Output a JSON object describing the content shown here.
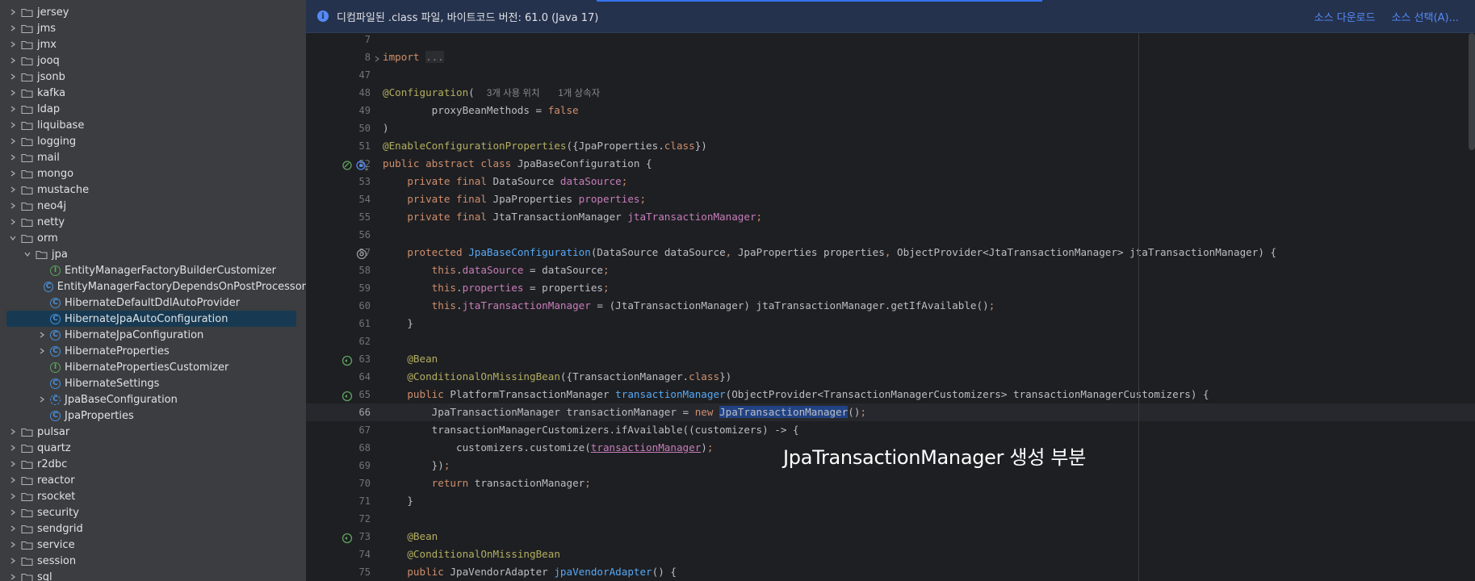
{
  "tree": {
    "folders_top": [
      "jersey",
      "jms",
      "jmx",
      "jooq",
      "jsonb",
      "kafka",
      "ldap",
      "liquibase",
      "logging",
      "mail",
      "mongo",
      "mustache",
      "neo4j",
      "netty"
    ],
    "orm": "orm",
    "jpa": "jpa",
    "jpa_children": [
      {
        "label": "EntityManagerFactoryBuilderCustomizer",
        "icon": "interface-icon",
        "expandable": false
      },
      {
        "label": "EntityManagerFactoryDependsOnPostProcessor",
        "icon": "class-icon",
        "expandable": false
      },
      {
        "label": "HibernateDefaultDdlAutoProvider",
        "icon": "class-icon",
        "expandable": false
      },
      {
        "label": "HibernateJpaAutoConfiguration",
        "icon": "class-icon",
        "expandable": false,
        "selected": true
      },
      {
        "label": "HibernateJpaConfiguration",
        "icon": "class-icon",
        "expandable": true
      },
      {
        "label": "HibernateProperties",
        "icon": "class-icon",
        "expandable": true
      },
      {
        "label": "HibernatePropertiesCustomizer",
        "icon": "interface-icon",
        "expandable": false
      },
      {
        "label": "HibernateSettings",
        "icon": "class-icon",
        "expandable": false
      },
      {
        "label": "JpaBaseConfiguration",
        "icon": "abstract-class-icon",
        "expandable": true
      },
      {
        "label": "JpaProperties",
        "icon": "class-icon",
        "expandable": false
      }
    ],
    "folders_bottom": [
      "pulsar",
      "quartz",
      "r2dbc",
      "reactor",
      "rsocket",
      "security",
      "sendgrid",
      "service",
      "session",
      "sql"
    ]
  },
  "banner": {
    "message": "디컴파일된 .class 파일, 바이트코드 버전: 61.0 (Java 17)",
    "download_sources": "소스 다운로드",
    "choose_sources": "소스 선택(A)..."
  },
  "editor": {
    "line_numbers": [
      "7",
      "8",
      "47",
      "48",
      "49",
      "50",
      "51",
      "52",
      "53",
      "54",
      "55",
      "56",
      "57",
      "58",
      "59",
      "60",
      "61",
      "62",
      "63",
      "64",
      "65",
      "66",
      "67",
      "68",
      "69",
      "70",
      "71",
      "72",
      "73",
      "74",
      "75"
    ],
    "current_line": "66",
    "hint_usages": "3개 사용 위치",
    "hint_inheritors": "1개 상속자",
    "folded_import": "..."
  },
  "overlay_caption": "JpaTransactionManager 생성 부분",
  "colors": {
    "tree_bg": "#3b3d40",
    "editor_bg": "#1e1f22",
    "banner_bg": "#25324d",
    "accent": "#548af7",
    "selection": "#173a52"
  }
}
